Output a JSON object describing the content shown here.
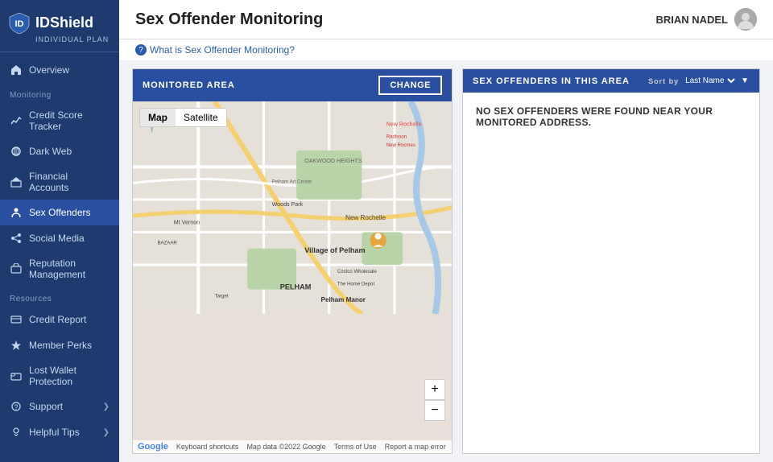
{
  "sidebar": {
    "logo_text": "IDShield",
    "logo_sub": "INDIVIDUAL PLAN",
    "overview_label": "Overview",
    "monitoring_section": "Monitoring",
    "resources_section": "Resources",
    "items": [
      {
        "label": "Overview",
        "icon": "home-icon",
        "active": false
      },
      {
        "label": "Credit Score Tracker",
        "icon": "chart-icon",
        "active": false
      },
      {
        "label": "Dark Web",
        "icon": "dark-web-icon",
        "active": false
      },
      {
        "label": "Financial Accounts",
        "icon": "bank-icon",
        "active": false
      },
      {
        "label": "Sex Offenders",
        "icon": "person-icon",
        "active": true
      },
      {
        "label": "Social Media",
        "icon": "social-icon",
        "active": false
      },
      {
        "label": "Reputation Management",
        "icon": "rep-icon",
        "active": false
      },
      {
        "label": "Credit Report",
        "icon": "credit-icon",
        "active": false
      },
      {
        "label": "Member Perks",
        "icon": "perks-icon",
        "active": false
      },
      {
        "label": "Lost Wallet Protection",
        "icon": "wallet-icon",
        "active": false
      },
      {
        "label": "Support",
        "icon": "support-icon",
        "active": false,
        "chevron": true
      },
      {
        "label": "Helpful Tips",
        "icon": "tips-icon",
        "active": false,
        "chevron": true
      }
    ]
  },
  "header": {
    "title": "Sex Offender Monitoring",
    "user_name": "BRIAN NADEL"
  },
  "help_link": "What is Sex Offender Monitoring?",
  "left_panel": {
    "header": "MONITORED AREA",
    "change_button": "CHANGE",
    "map_type_options": [
      "Map",
      "Satellite"
    ],
    "map_zoom_plus": "+",
    "map_zoom_minus": "−",
    "attribution_keyboard": "Keyboard shortcuts",
    "attribution_data": "Map data ©2022 Google",
    "attribution_terms": "Terms of Use",
    "attribution_report": "Report a map error"
  },
  "right_panel": {
    "header": "SEX OFFENDERS IN THIS AREA",
    "sort_by_label": "Sort By",
    "sort_by_value": "Last Name",
    "no_results_message": "NO SEX OFFENDERS WERE FOUND NEAR YOUR MONITORED ADDRESS."
  }
}
